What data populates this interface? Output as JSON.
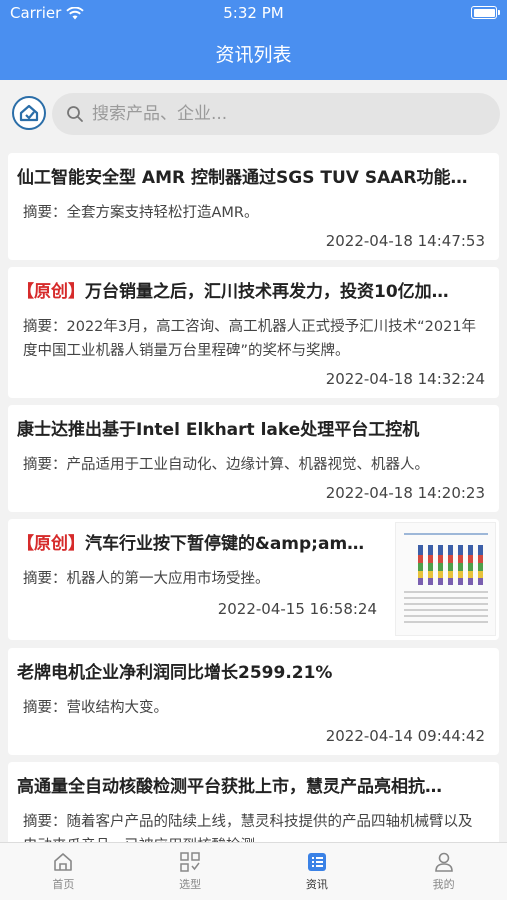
{
  "status_bar": {
    "carrier": "Carrier",
    "time": "5:32 PM"
  },
  "header": {
    "title": "资讯列表"
  },
  "search": {
    "placeholder": "搜索产品、企业..."
  },
  "articles": [
    {
      "tag": "",
      "title": "仙工智能安全型 AMR 控制器通过SGS TUV SAAR功能…",
      "summary": "摘要：全套方案支持轻松打造AMR。",
      "time": "2022-04-18 14:47:53"
    },
    {
      "tag": "【原创】",
      "title": "万台销量之后，汇川技术再发力，投资10亿加…",
      "summary": "摘要：2022年3月，高工咨询、高工机器人正式授予汇川技术“2021年度中国工业机器人销量万台里程碑”的奖杯与奖牌。",
      "time": "2022-04-18 14:32:24"
    },
    {
      "tag": "",
      "title": "康士达推出基于Intel Elkhart lake处理平台工控机",
      "summary": "摘要：产品适用于工业自动化、边缘计算、机器视觉、机器人。",
      "time": "2022-04-18 14:20:23"
    },
    {
      "tag": "【原创】",
      "title": "汽车行业按下暂停键的&amp;am…",
      "summary": "摘要：机器人的第一大应用市场受挫。",
      "time": "2022-04-15 16:58:24",
      "has_thumbnail": true
    },
    {
      "tag": "",
      "title": "老牌电机企业净利润同比增长2599.21%",
      "summary": "摘要：营收结构大变。",
      "time": "2022-04-14 09:44:42"
    },
    {
      "tag": "",
      "title": "高通量全自动核酸检测平台获批上市，慧灵产品亮相抗…",
      "summary": "摘要：随着客户产品的陆续上线，慧灵科技提供的产品四轴机械臂以及电动夹爪产品，已被应用到核酸检测...",
      "time": ""
    }
  ],
  "tabbar": {
    "items": [
      {
        "label": "首页",
        "icon": "home-icon",
        "active": false
      },
      {
        "label": "选型",
        "icon": "selection-icon",
        "active": false
      },
      {
        "label": "资讯",
        "icon": "news-icon",
        "active": true
      },
      {
        "label": "我的",
        "icon": "profile-icon",
        "active": false
      }
    ]
  },
  "colors": {
    "header_bg": "#4a8ff0",
    "tag_red": "#d62b2b",
    "active_tab": "#3b82e6"
  }
}
